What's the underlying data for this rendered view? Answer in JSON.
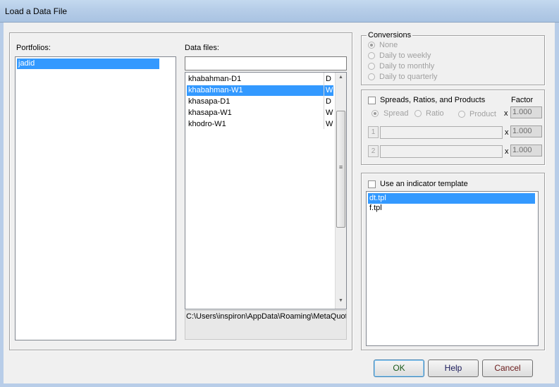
{
  "window": {
    "title": "Load a Data File"
  },
  "portfolios": {
    "label": "Portfolios:",
    "items": [
      "jadid"
    ],
    "selected_index": 0
  },
  "data_files": {
    "label": "Data files:",
    "filter_value": "",
    "items": [
      {
        "name": "khabahman-D1",
        "period": "D"
      },
      {
        "name": "khabahman-W1",
        "period": "W"
      },
      {
        "name": "khasapa-D1",
        "period": "D"
      },
      {
        "name": "khasapa-W1",
        "period": "W"
      },
      {
        "name": "khodro-W1",
        "period": "W"
      }
    ],
    "selected_index": 1,
    "path": "C:\\Users\\inspiron\\AppData\\Roaming\\MetaQuot"
  },
  "conversions": {
    "title": "Conversions",
    "options": [
      "None",
      "Daily to weekly",
      "Daily to monthly",
      "Daily to quarterly"
    ],
    "selected_index": 0
  },
  "spreads": {
    "checkbox_label": "Spreads, Ratios, and Products",
    "checked": false,
    "factor_label": "Factor",
    "modes": [
      "Spread",
      "Ratio",
      "Product"
    ],
    "selected_mode": 0,
    "times": "x",
    "factor_main": "1.000",
    "row1": {
      "index": "1",
      "value": "",
      "factor": "1.000"
    },
    "row2": {
      "index": "2",
      "value": "",
      "factor": "1.000"
    }
  },
  "template": {
    "checkbox_label": "Use an indicator template",
    "checked": false,
    "items": [
      "dt.tpl",
      "f.tpl"
    ],
    "selected_index": 0
  },
  "buttons": {
    "ok": "OK",
    "help": "Help",
    "cancel": "Cancel"
  }
}
